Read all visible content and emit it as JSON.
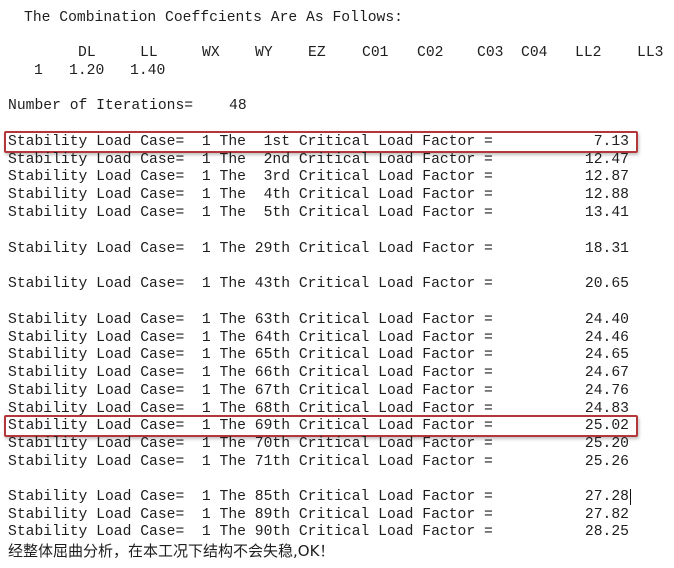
{
  "heading": "The Combination Coeffcients Are As Follows:",
  "combination_table": {
    "headers": [
      "DL",
      "LL",
      "WX",
      "WY",
      "EZ",
      "C01",
      "C02",
      "C03",
      "C04",
      "LL2",
      "LL3"
    ],
    "row": {
      "case": "1",
      "values": [
        "1.20",
        "1.40"
      ]
    }
  },
  "iterations": {
    "label": "Number of Iterations=",
    "value": "48"
  },
  "stability_rows": [
    {
      "text": "Stability Load Case=  1 The  1st Critical Load Factor =",
      "value": "7.13",
      "highlighted": true
    },
    {
      "text": "Stability Load Case=  1 The  2nd Critical Load Factor =",
      "value": "12.47"
    },
    {
      "text": "Stability Load Case=  1 The  3rd Critical Load Factor =",
      "value": "12.87"
    },
    {
      "text": "Stability Load Case=  1 The  4th Critical Load Factor =",
      "value": "12.88"
    },
    {
      "text": "Stability Load Case=  1 The  5th Critical Load Factor =",
      "value": "13.41"
    },
    {
      "text": "Stability Load Case=  1 The 29th Critical Load Factor =",
      "value": "18.31"
    },
    {
      "text": "Stability Load Case=  1 The 43th Critical Load Factor =",
      "value": "20.65"
    },
    {
      "text": "Stability Load Case=  1 The 63th Critical Load Factor =",
      "value": "24.40"
    },
    {
      "text": "Stability Load Case=  1 The 64th Critical Load Factor =",
      "value": "24.46"
    },
    {
      "text": "Stability Load Case=  1 The 65th Critical Load Factor =",
      "value": "24.65"
    },
    {
      "text": "Stability Load Case=  1 The 66th Critical Load Factor =",
      "value": "24.67"
    },
    {
      "text": "Stability Load Case=  1 The 67th Critical Load Factor =",
      "value": "24.76"
    },
    {
      "text": "Stability Load Case=  1 The 68th Critical Load Factor =",
      "value": "24.83"
    },
    {
      "text": "Stability Load Case=  1 The 69th Critical Load Factor =",
      "value": "25.02",
      "highlighted": true
    },
    {
      "text": "Stability Load Case=  1 The 70th Critical Load Factor =",
      "value": "25.20"
    },
    {
      "text": "Stability Load Case=  1 The 71th Critical Load Factor =",
      "value": "25.26"
    },
    {
      "text": "Stability Load Case=  1 The 85th Critical Load Factor =",
      "value": "27.28"
    },
    {
      "text": "Stability Load Case=  1 The 89th Critical Load Factor =",
      "value": "27.82"
    },
    {
      "text": "Stability Load Case=  1 The 90th Critical Load Factor =",
      "value": "28.25"
    }
  ],
  "conclusion": "经整体屈曲分析，在本工况下结构不会失稳,OK！",
  "colors": {
    "highlight_box": "#b3363a",
    "text": "#1e1e1e"
  }
}
